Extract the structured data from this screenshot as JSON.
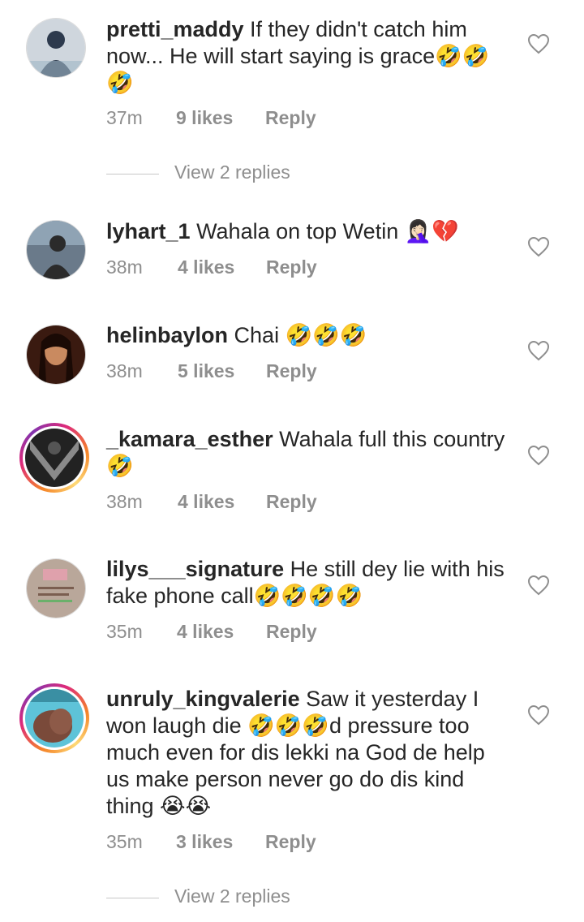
{
  "comments": [
    {
      "username": "pretti_maddy",
      "text": " If they didn't catch him\nnow... He will start saying is grace🤣🤣\n🤣",
      "time": "37m",
      "likes": "9 likes",
      "reply": "Reply",
      "view_replies": "View 2 replies",
      "avatar_colors": [
        "#cfd6dd",
        "#2d3a4d"
      ]
    },
    {
      "username": "lyhart_1",
      "text": " Wahala on top Wetin 🤦🏻‍♀️💔",
      "time": "38m",
      "likes": "4 likes",
      "reply": "Reply",
      "avatar_colors": [
        "#6a7a8a",
        "#2b2b2b"
      ]
    },
    {
      "username": "helinbaylon",
      "text": " Chai 🤣🤣🤣",
      "time": "38m",
      "likes": "5 likes",
      "reply": "Reply",
      "avatar_colors": [
        "#3a1a10",
        "#c98a60"
      ]
    },
    {
      "username": "_kamara_esther",
      "text": " Wahala full this country\n🤣",
      "time": "38m",
      "likes": "4 likes",
      "reply": "Reply",
      "avatar_colors": [
        "#222222",
        "#8a8a8a"
      ]
    },
    {
      "username": "lilys___signature",
      "text": " He still dey lie with his\nfake phone call🤣🤣🤣🤣",
      "time": "35m",
      "likes": "4 likes",
      "reply": "Reply",
      "avatar_colors": [
        "#b9a79a",
        "#7a5e50"
      ]
    },
    {
      "username": "unruly_kingvalerie",
      "text": " Saw it yesterday I\nwon laugh die 🤣🤣🤣d pressure too\nmuch even for dis lekki na God de help\nus make person never go do dis kind\nthing 😭😭",
      "time": "35m",
      "likes": "3 likes",
      "reply": "Reply",
      "view_replies": "View 2 replies",
      "avatar_colors": [
        "#5ec3d8",
        "#7a4a3a"
      ]
    }
  ]
}
